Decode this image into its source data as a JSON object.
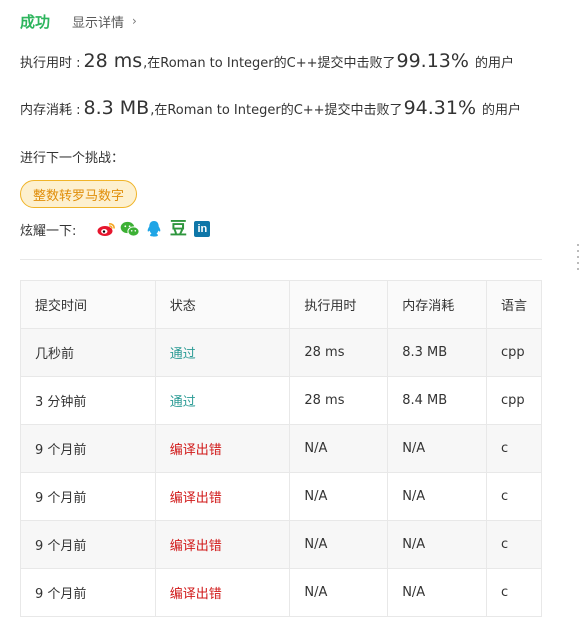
{
  "header": {
    "status": "成功",
    "details_link": "显示详情",
    "details_chevron": "›"
  },
  "runtime": {
    "label": "执行用时 :",
    "value": "28 ms",
    "comma": ",",
    "text": "在Roman to Integer的C++提交中击败了",
    "percent": "99.13%",
    "suffix": "的用户"
  },
  "memory": {
    "label": "内存消耗 :",
    "value": "8.3 MB",
    "comma": ",",
    "text": "在Roman to Integer的C++提交中击败了",
    "percent": "94.31%",
    "suffix": "的用户"
  },
  "challenge": {
    "label": "进行下一个挑战：",
    "tag": "整数转罗马数字"
  },
  "share": {
    "label": "炫耀一下:",
    "icons": [
      "weibo-icon",
      "wechat-icon",
      "qq-icon",
      "douban-icon",
      "linkedin-icon"
    ],
    "douban_glyph": "豆",
    "linkedin_glyph": "in"
  },
  "colors": {
    "success": "#2db55d",
    "accepted": "#2b9b95",
    "error": "#d11a1a",
    "tag_border": "#f0b429",
    "tag_bg": "#fdf0cf"
  },
  "table": {
    "headers": [
      "提交时间",
      "状态",
      "执行用时",
      "内存消耗",
      "语言"
    ],
    "rows": [
      {
        "time": "几秒前",
        "status": "通过",
        "runtime": "28 ms",
        "memory": "8.3 MB",
        "lang": "cpp"
      },
      {
        "time": "3 分钟前",
        "status": "通过",
        "runtime": "28 ms",
        "memory": "8.4 MB",
        "lang": "cpp"
      },
      {
        "time": "9 个月前",
        "status": "编译出错",
        "runtime": "N/A",
        "memory": "N/A",
        "lang": "c"
      },
      {
        "time": "9 个月前",
        "status": "编译出错",
        "runtime": "N/A",
        "memory": "N/A",
        "lang": "c"
      },
      {
        "time": "9 个月前",
        "status": "编译出错",
        "runtime": "N/A",
        "memory": "N/A",
        "lang": "c"
      },
      {
        "time": "9 个月前",
        "status": "编译出错",
        "runtime": "N/A",
        "memory": "N/A",
        "lang": "c"
      }
    ]
  }
}
